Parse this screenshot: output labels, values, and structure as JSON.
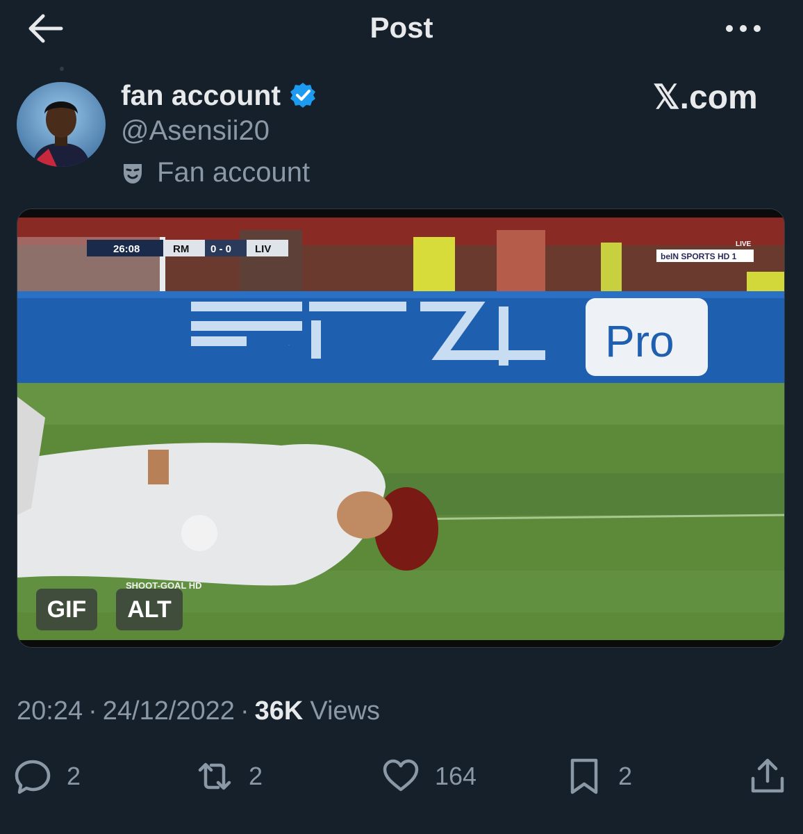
{
  "header": {
    "title": "Post",
    "back_icon": "arrow-left-icon",
    "more_icon": "ellipsis-icon"
  },
  "author": {
    "name": "fan account",
    "handle": "@Asensii20",
    "label": "Fan account",
    "verified": true,
    "verified_color": "#1d9bf0",
    "label_icon": "theater-mask-icon"
  },
  "watermark": "𝕏.com",
  "media": {
    "type": "gif",
    "badges": {
      "gif": "GIF",
      "alt": "ALT"
    },
    "scoreboard": {
      "time": "26:08",
      "home": "RM",
      "score": "0 - 0",
      "away": "LIV"
    },
    "broadcaster": "beIN SPORTS HD 1",
    "live": "LIVE",
    "board_text": "PS4",
    "board_badge": "Pro",
    "caption": "SHOOT-GOAL HD"
  },
  "meta": {
    "time": "20:24",
    "date": "24/12/2022",
    "views_count": "36K",
    "views_label": "Views"
  },
  "actions": {
    "reply": {
      "icon": "reply-icon",
      "count": "2"
    },
    "retweet": {
      "icon": "retweet-icon",
      "count": "2"
    },
    "like": {
      "icon": "heart-icon",
      "count": "164"
    },
    "bookmark": {
      "icon": "bookmark-icon",
      "count": "2"
    },
    "share": {
      "icon": "share-icon"
    }
  },
  "colors": {
    "background": "#15202b",
    "muted": "#8b98a5",
    "text": "#e7e9ea",
    "accent": "#1d9bf0"
  }
}
